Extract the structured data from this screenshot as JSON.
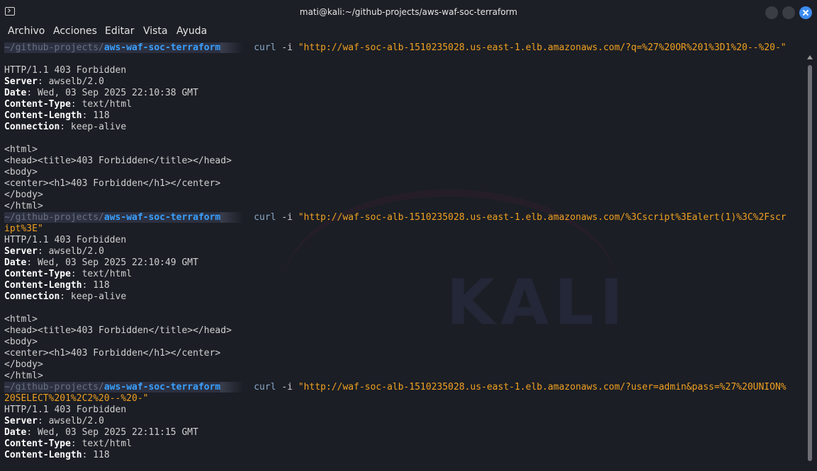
{
  "window": {
    "title": "mati@kali:~/github-projects/aws-waf-soc-terraform"
  },
  "menu": {
    "items": [
      "Archivo",
      "Acciones",
      "Editar",
      "Vista",
      "Ayuda"
    ]
  },
  "background": {
    "watermark": "KALI"
  },
  "prompt": {
    "path": "~/github-projects/",
    "dir": "aws-waf-soc-terraform"
  },
  "commands": [
    {
      "cmd": "curl",
      "opt": "-i",
      "url_line1": "\"http://waf-soc-alb-1510235028.us-east-1.elb.amazonaws.com/?q=%27%20OR%201%3D1%20--%20-\"",
      "url_line2": ""
    },
    {
      "cmd": "curl",
      "opt": "-i",
      "url_line1": "\"http://waf-soc-alb-1510235028.us-east-1.elb.amazonaws.com/%3Cscript%3Ealert(1)%3C%2Fscr",
      "url_line2": "ipt%3E\""
    },
    {
      "cmd": "curl",
      "opt": "-i",
      "url_line1": "\"http://waf-soc-alb-1510235028.us-east-1.elb.amazonaws.com/?user=admin&pass=%27%20UNION%",
      "url_line2": "20SELECT%201%2C2%20--%20-\""
    }
  ],
  "responses": [
    {
      "status": "HTTP/1.1 403 Forbidden",
      "headers": [
        {
          "key": "Server",
          "value": " awselb/2.0"
        },
        {
          "key": "Date",
          "value": " Wed, 03 Sep 2025 22:10:38 GMT"
        },
        {
          "key": "Content-Type",
          "value": " text/html"
        },
        {
          "key": "Content-Length",
          "value": " 118"
        },
        {
          "key": "Connection",
          "value": " keep-alive"
        }
      ],
      "body": [
        "<html>",
        "<head><title>403 Forbidden</title></head>",
        "<body>",
        "<center><h1>403 Forbidden</h1></center>",
        "</body>",
        "</html>"
      ]
    },
    {
      "status": "HTTP/1.1 403 Forbidden",
      "headers": [
        {
          "key": "Server",
          "value": " awselb/2.0"
        },
        {
          "key": "Date",
          "value": " Wed, 03 Sep 2025 22:10:49 GMT"
        },
        {
          "key": "Content-Type",
          "value": " text/html"
        },
        {
          "key": "Content-Length",
          "value": " 118"
        },
        {
          "key": "Connection",
          "value": " keep-alive"
        }
      ],
      "body": [
        "<html>",
        "<head><title>403 Forbidden</title></head>",
        "<body>",
        "<center><h1>403 Forbidden</h1></center>",
        "</body>",
        "</html>"
      ]
    },
    {
      "status": "HTTP/1.1 403 Forbidden",
      "headers": [
        {
          "key": "Server",
          "value": " awselb/2.0"
        },
        {
          "key": "Date",
          "value": " Wed, 03 Sep 2025 22:11:15 GMT"
        },
        {
          "key": "Content-Type",
          "value": " text/html"
        },
        {
          "key": "Content-Length",
          "value": " 118"
        }
      ],
      "body": []
    }
  ],
  "colors": {
    "prompt_dir": "#39a0ff",
    "url": "#f0a020",
    "close_button": "#3d8cf0"
  }
}
